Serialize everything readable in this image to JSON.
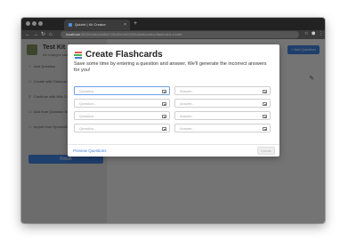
{
  "browser": {
    "tab_title": "Quizlet | Kit Creator",
    "tab_close": "×",
    "new_tab": "+",
    "url_host": "localhost",
    "url_path": ":3000/chains/b8b6726c56e4d09260a6b8/author/flashcard-create",
    "nav": {
      "back": "←",
      "forward": "→",
      "reload": "↻",
      "home": "⌂"
    },
    "bar_icons": {
      "star": "☆",
      "extensions": "⬢",
      "menu": "⋮"
    }
  },
  "sidebar": {
    "kit_title": "Test Kit",
    "kit_subtitle": "All changes saved",
    "items": [
      {
        "icon": "+",
        "label": "Add Question"
      },
      {
        "icon": "☐",
        "label": "Create with Flashcards"
      },
      {
        "icon": "⚲",
        "label": "Continue with Wiki Cards"
      },
      {
        "icon": "☐",
        "label": "Add from Question Bank"
      },
      {
        "icon": "☐",
        "label": "Import from Spreadsheet"
      }
    ],
    "bottom_button": "Finish"
  },
  "main": {
    "add_question_button": "+ Add Question",
    "pencil_icon": "✎"
  },
  "modal": {
    "title": "Create Flashcards",
    "description": "Save some time by entering a question and answer. We'll generate the incorrect answers for you!",
    "rows": [
      {
        "question_placeholder": "Question...",
        "answer_placeholder": "Answer...",
        "question_value": "",
        "answer_value": ""
      },
      {
        "question_placeholder": "Question...",
        "answer_placeholder": "Answer...",
        "question_value": "",
        "answer_value": ""
      },
      {
        "question_placeholder": "Question...",
        "answer_placeholder": "Answer...",
        "question_value": "",
        "answer_value": ""
      },
      {
        "question_placeholder": "Question...",
        "answer_placeholder": "Answer...",
        "question_value": "",
        "answer_value": ""
      }
    ],
    "preview_link": "Preview Questions",
    "create_button": "Create"
  },
  "colors": {
    "accent": "#3e7ed8",
    "overlay": "rgba(0,0,0,0.5)"
  }
}
